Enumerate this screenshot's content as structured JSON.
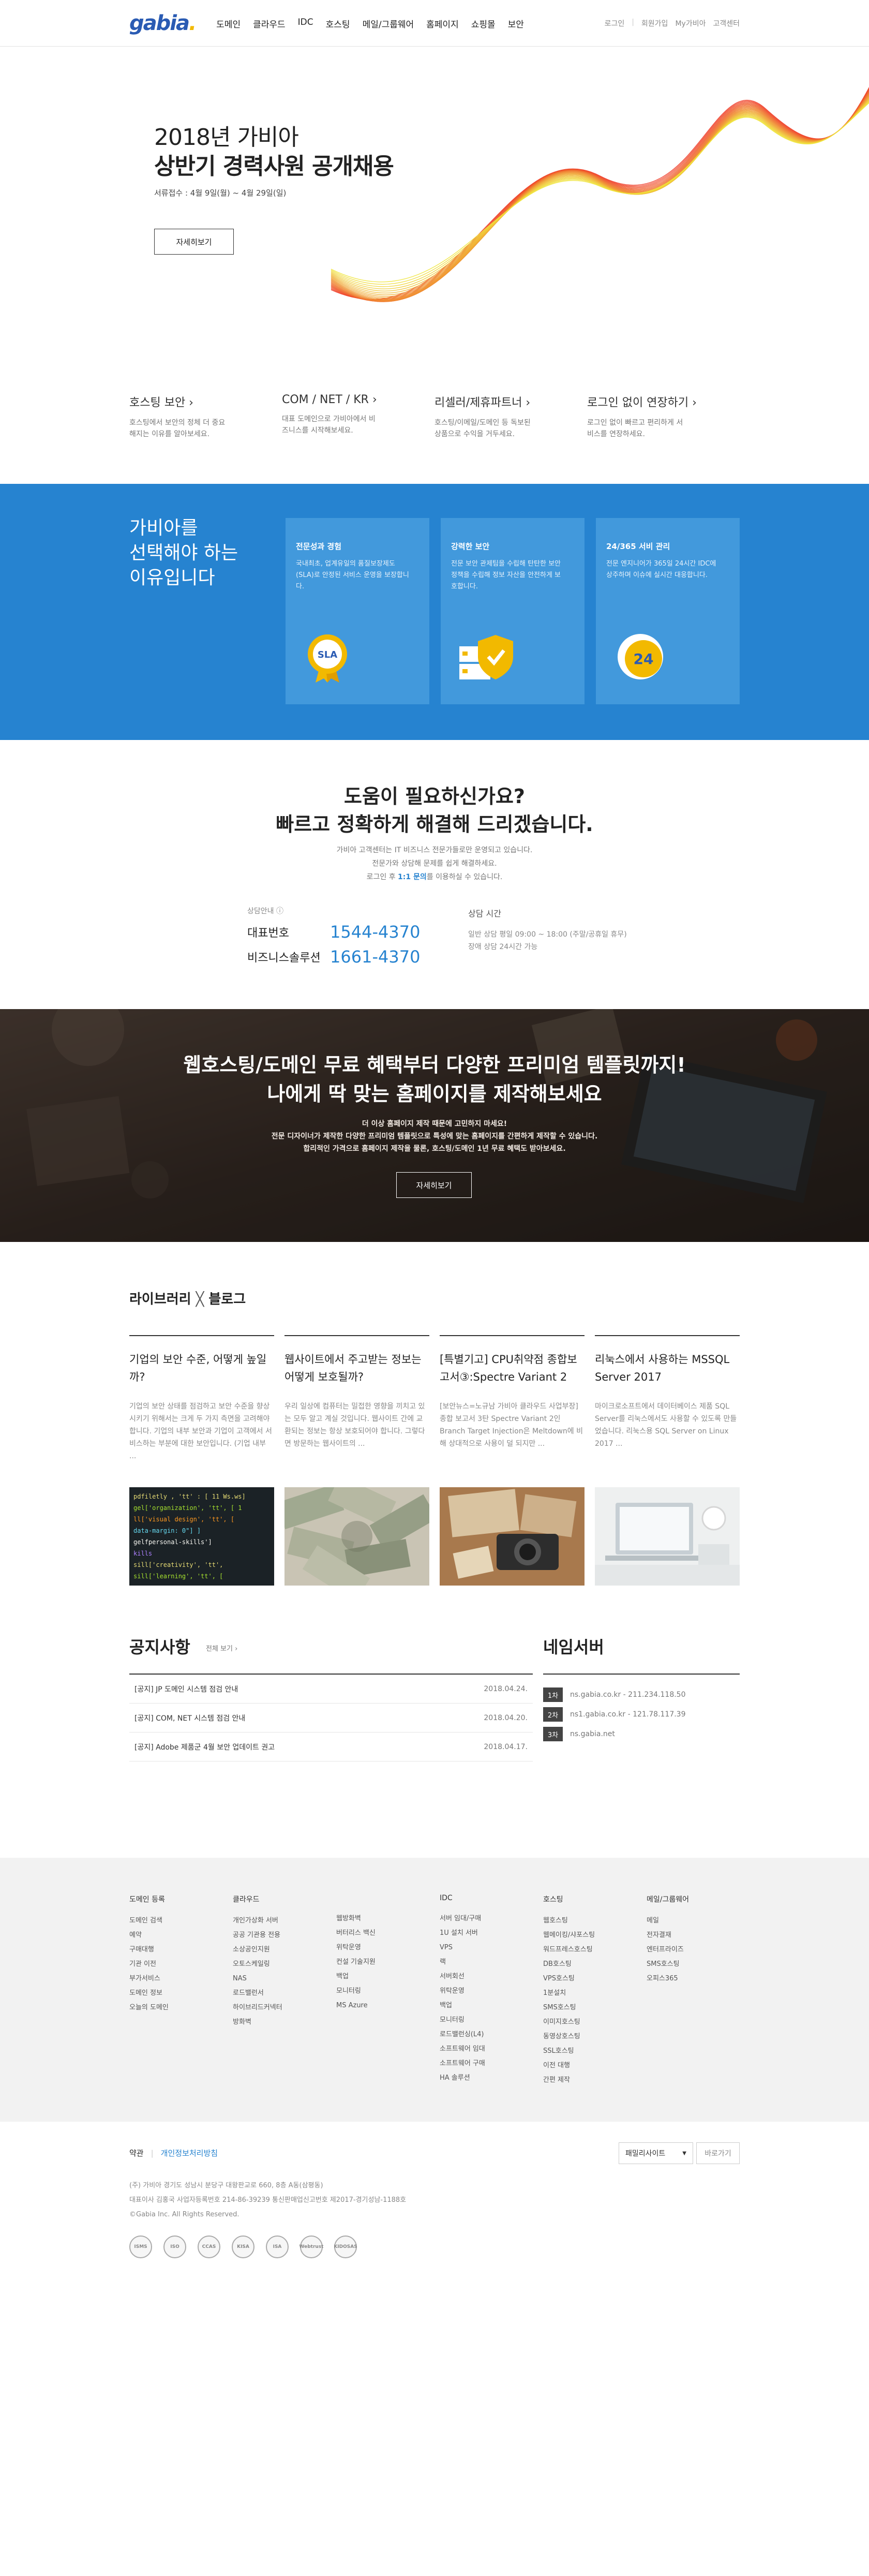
{
  "header": {
    "logo": "gabia",
    "logo_dot": ".",
    "nav": [
      "도메인",
      "클라우드",
      "IDC",
      "호스팅",
      "메일/그룹웨어",
      "홈페이지",
      "쇼핑몰",
      "보안"
    ],
    "util": [
      "로그인",
      "회원가입",
      "My가비아",
      "고객센터"
    ]
  },
  "hero": {
    "title_line1": "2018년 가비아",
    "title_line2": "상반기 경력사원 공개채용",
    "date": "서류접수 : 4월 9일(월) ~ 4월 29일(일)",
    "button": "자세히보기"
  },
  "quick": [
    {
      "title": "호스팅 보안 ›",
      "desc": "호스팅에서 보안의 정체 더 중요해지는 이유를 알아보세요."
    },
    {
      "title": "COM / NET / KR ›",
      "desc": "대표 도메인으로 가비아에서 비즈니스를 시작해보세요."
    },
    {
      "title": "리셀러/제휴파트너 ›",
      "desc": "호스팅/이메일/도메인 등 독보된 상품으로 수익을 거두세요."
    },
    {
      "title": "로그인 없이 연장하기 ›",
      "desc": "로그인 없이 빠르고 편리하게 서비스를 연장하세요."
    }
  ],
  "why": {
    "title_lines": [
      "가비아를",
      "선택해야 하는",
      "이유입니다"
    ],
    "cards": [
      {
        "title": "전문성과 경험",
        "desc": "국내최초, 업계유일의 품질보장제도(SLA)로 안정된 서비스 운영을 보장합니다.",
        "icon": "sla-badge-icon",
        "icon_text": "SLA"
      },
      {
        "title": "강력한 보안",
        "desc": "전문 보안 관제팀을 수립해 탄탄한 보안 정책을 수립해 정보 자산을 안전하게 보호합니다.",
        "icon": "shield-server-icon"
      },
      {
        "title": "24/365 서비 관리",
        "desc": "전문 엔지니어가 365일 24시간 IDC에 상주하며 이슈에 실시간 대응합니다.",
        "icon": "clock-24-icon",
        "icon_text": "24"
      }
    ]
  },
  "help": {
    "title_line1": "도움이 필요하신가요?",
    "title_line2": "빠르고 정확하게 해결해 드리겠습니다.",
    "desc_line1": "가비아 고객센터는 IT 비즈니스 전문가들로만 운영되고 있습니다.",
    "desc_line2": "전문가와 상담해 문제를 쉽게 해결하세요.",
    "desc_line3_a": "로그인 후 ",
    "desc_line3_b": "1:1 문의",
    "desc_line3_c": "를 이용하실 수 있습니다.",
    "phone_label": "상담안내 ⓘ",
    "phones": [
      {
        "label": "대표번호",
        "number": "1544-4370"
      },
      {
        "label": "비즈니스솔루션",
        "number": "1661-4370"
      }
    ],
    "hours_label": "상담 시간",
    "hours_line1": "일반 상담 평일 09:00 ~ 18:00 (주말/공휴일 휴무)",
    "hours_line2": "장애 상담 24시간 가능"
  },
  "band": {
    "title_line1": "웹호스팅/도메인 무료 혜택부터 다양한 프리미엄 템플릿까지!",
    "title_line2": "나에게 딱 맞는 홈페이지를 제작해보세요",
    "desc_line1": "더 이상 홈페이지 제작 때문에 고민하지 마세요!",
    "desc_line2": "전문 디자이너가 제작한 다양한 프리미엄 템플릿으로 특성에 맞는 홈페이지를 간편하게 제작할 수 있습니다.",
    "desc_line3": "합리적인 가격으로 홈페이지 제작을 물론, 호스팅/도메인 1년 무료 혜택도 받아보세요.",
    "button": "자세히보기"
  },
  "blog": {
    "title_a": "라이브러리",
    "title_x": "╳",
    "title_b": "블로그",
    "posts": [
      {
        "title": "기업의 보안 수준, 어떻게 높일까?",
        "desc": "기업의 보안 상태를 점검하고 보안 수준을 향상시키기 위해서는 크게 두 가지 측면을 고려해야 합니다. 기업의 내부 보안과 기업이 고객에서 서비스하는 부분에 대한 보안입니다. (기업 내부 ..."
      },
      {
        "title": "웹사이트에서 주고받는 정보는 어떻게 보호될까?",
        "desc": "우리 일상에 컴퓨터는 밀접한 영향을 끼치고 있는 모두 알고 계실 것입니다. 웹사이트 간에 교환되는 정보는 항상 보호되어야 합니다. 그렇다면 방문하는 웹사이트의 ..."
      },
      {
        "title": "[특별기고] CPU취약점 종합보고서③:Spectre Variant 2",
        "desc": "[보안뉴스=노규남 가비아 클라우드 사업부장] 종합 보고서 3탄 Spectre Variant 2인 Branch Target Injection은 Meltdown에 비해 상대적으로 사용이 덜 되지만 ..."
      },
      {
        "title": "리눅스에서 사용하는 MSSQL Server 2017",
        "desc": "마이크로소프트에서 데이터베이스 제품 SQL Server를 리눅스에서도 사용할 수 있도록 만들었습니다. 리눅스용 SQL Server on Linux 2017 ..."
      }
    ]
  },
  "notice": {
    "title": "공지사항",
    "more": "전체 보기 ›",
    "items": [
      {
        "text": "[공지] JP 도메인 시스템 점검 안내",
        "date": "2018.04.24."
      },
      {
        "text": "[공지] COM, NET 시스템 점검 안내",
        "date": "2018.04.20."
      },
      {
        "text": "[공지] Adobe 제품군 4월 보안 업데이트 권고",
        "date": "2018.04.17."
      }
    ]
  },
  "nameserver": {
    "title": "네임서버",
    "items": [
      {
        "badge": "1차",
        "text": "ns.gabia.co.kr - 211.234.118.50"
      },
      {
        "badge": "2차",
        "text": "ns1.gabia.co.kr - 121.78.117.39"
      },
      {
        "badge": "3차",
        "text": "ns.gabia.net"
      }
    ]
  },
  "sitemap": [
    {
      "head": "도메인 등록",
      "items": [
        "도메인 검색",
        "예약",
        "구매대행",
        "기관 이전",
        "부가서비스",
        "도메인 정보",
        "오늘의 도메인"
      ]
    },
    {
      "head": "클라우드",
      "items": [
        "개인가상화 서버",
        "공공 기관용 전용",
        "소상공인지원",
        "오토스케일링",
        "NAS",
        "로드밸런서",
        "하이브리드커넥터",
        "방화벽"
      ]
    },
    {
      "head": "",
      "items": [
        "웹방화벽",
        "버터리스 백신",
        "위탁운영",
        "컨설 기술지원",
        "백업",
        "모니터링",
        "MS Azure"
      ]
    },
    {
      "head": "IDC",
      "items": [
        "서버 임대/구매",
        "1U 설치 서버",
        "VPS",
        "랙",
        "서버회선",
        "위탁운영",
        "백업",
        "모니터링",
        "로드밸런싱(L4)",
        "소프트웨어 임대",
        "소프트웨어 구매",
        "HA 솔루션"
      ]
    },
    {
      "head": "호스팅",
      "items": [
        "웹호스팅",
        "웹메이킹/샤포스팅",
        "워드프레스호스팅",
        "DB호스팅",
        "VPS호스팅",
        "1분설치",
        "SMS호스팅",
        "이미지호스팅",
        "동영상호스팅",
        "SSL호스팅",
        "이전 대행",
        "간편 제작"
      ]
    },
    {
      "head": "메일/그룹웨어",
      "items": [
        "메일",
        "전자결재",
        "엔터프라이즈",
        "SMS호스팅",
        "오피스365"
      ]
    }
  ],
  "footer": {
    "links": [
      "약관",
      "개인정보처리방침"
    ],
    "family_select": "패밀리사이트",
    "go_button": "바로가기",
    "info_line1": "(주) 가비아     경기도 성남시 분당구 대왕판교로 660, 8층 A동(삼평동)",
    "info_line2": "대표이사 김홍국     사업자등록번호 214-86-39239     통신판매업신고번호 제2017-경기성남-1188호",
    "info_line3": "©Gabia Inc. All Rights Reserved.",
    "certs": [
      "ISMS",
      "ISO",
      "CCAS",
      "KISA",
      "ISA",
      "Webtrust",
      "KIDOSAS"
    ]
  },
  "colors": {
    "brand_blue": "#2683d0",
    "logo_blue": "#2a5bb3",
    "logo_yellow": "#f2b900"
  }
}
